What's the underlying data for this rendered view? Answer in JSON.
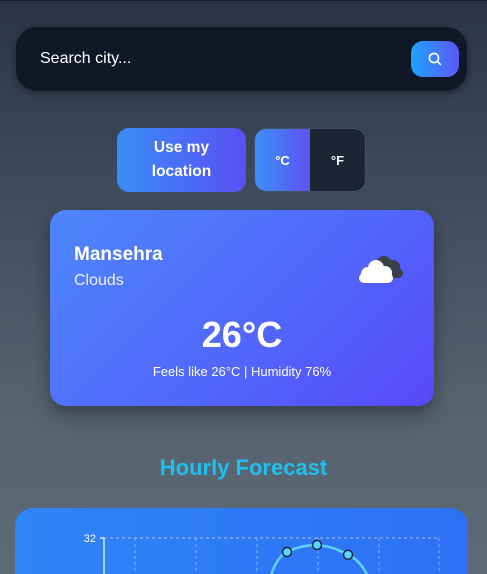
{
  "search": {
    "placeholder": "Search city...",
    "button_icon": "search-icon"
  },
  "controls": {
    "location_label": "Use my location",
    "unit_celsius": "°C",
    "unit_fahrenheit": "°F",
    "selected_unit": "°C"
  },
  "current": {
    "city": "Mansehra",
    "condition": "Clouds",
    "condition_icon": "cloud-icon",
    "temperature": "26°C",
    "details": "Feels like 26°C | Humidity 76%"
  },
  "hourly": {
    "title": "Hourly Forecast"
  },
  "chart_data": {
    "type": "line",
    "y_tick_labels": [
      "32"
    ],
    "series": [
      {
        "values": [
          31,
          31.5,
          30.8
        ]
      }
    ]
  },
  "colors": {
    "accent_start": "#1fa2ff",
    "accent_end": "#5a58f5",
    "title_color": "#1fc0f0",
    "card_background": "#5168fb"
  }
}
